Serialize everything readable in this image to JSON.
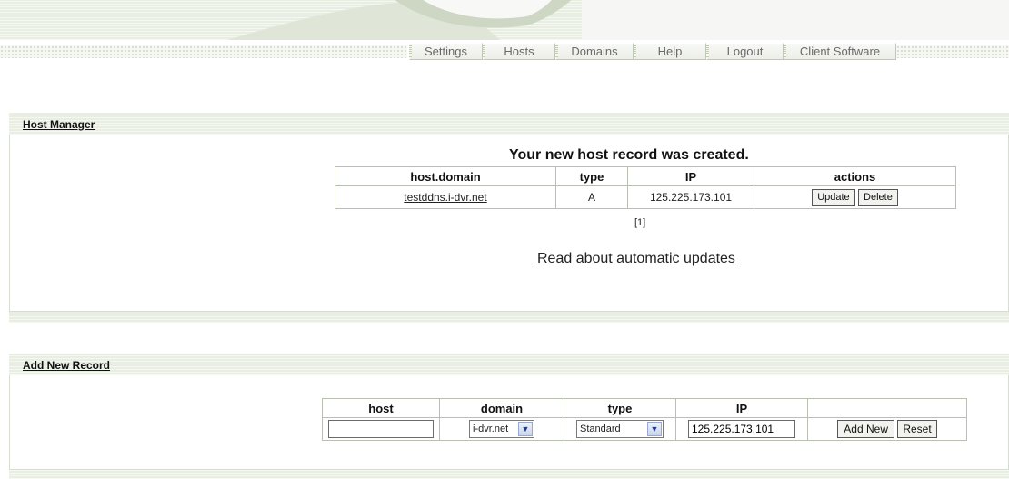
{
  "nav": {
    "items": [
      "Settings",
      "Hosts",
      "Domains",
      "Help",
      "Logout",
      "Client Software"
    ]
  },
  "host_manager": {
    "title": "Host Manager",
    "status_message": "Your new host record was created.",
    "table": {
      "headers": [
        "host.domain",
        "type",
        "IP",
        "actions"
      ],
      "rows": [
        {
          "host_domain": "testddns.i-dvr.net",
          "type": "A",
          "ip": "125.225.173.101",
          "update_label": "Update",
          "delete_label": "Delete"
        }
      ]
    },
    "pagination": "[1]",
    "auto_updates_link": "Read about automatic updates"
  },
  "add_record": {
    "title": "Add New Record",
    "headers": [
      "host",
      "domain",
      "type",
      "IP"
    ],
    "host_value": "",
    "domain_selected": "i-dvr.net",
    "type_selected": "Standard",
    "ip_value": "125.225.173.101",
    "add_label": "Add New",
    "reset_label": "Reset"
  },
  "colors": {
    "band": "#e9eee3",
    "border": "#b9c0b2",
    "select_arrow": "#1f3a8a"
  },
  "icons": {
    "select_arrow": "chevron-down-icon"
  }
}
